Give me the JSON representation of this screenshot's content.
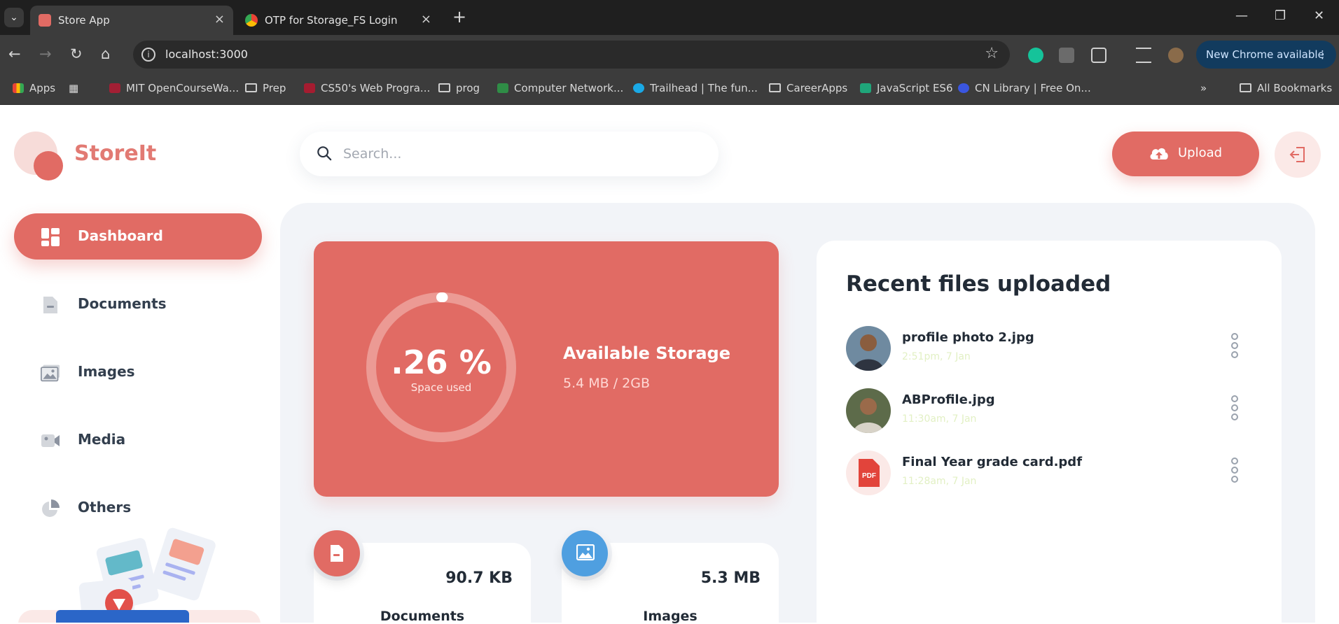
{
  "browser": {
    "tabs": [
      {
        "title": "Store App"
      },
      {
        "title": "OTP for Storage_FS Login - adit"
      }
    ],
    "url": "localhost:3000",
    "update_label": "New Chrome available",
    "bookmarks": [
      "Apps",
      "MIT OpenCourseWa...",
      "Prep",
      "CS50's Web Progra...",
      "prog",
      "Computer Network...",
      "Trailhead | The fun...",
      "CareerApps",
      "JavaScript ES6",
      "CN Library | Free On..."
    ],
    "all_bookmarks": "All Bookmarks"
  },
  "app": {
    "brand": "StoreIt",
    "search_placeholder": "Search...",
    "upload_label": "Upload",
    "accent": "#e16b64",
    "sidebar": [
      {
        "label": "Dashboard",
        "icon": "dashboard-icon",
        "active": true
      },
      {
        "label": "Documents",
        "icon": "document-icon",
        "active": false
      },
      {
        "label": "Images",
        "icon": "images-icon",
        "active": false
      },
      {
        "label": "Media",
        "icon": "video-icon",
        "active": false
      },
      {
        "label": "Others",
        "icon": "pie-chart-icon",
        "active": false
      }
    ],
    "storage": {
      "percent": ".26 %",
      "percent_label": "Space used",
      "used_fraction": 0.0026,
      "title": "Available Storage",
      "usage": "5.4 MB / 2GB"
    },
    "summary": [
      {
        "title": "Documents",
        "size": "90.7 KB",
        "color": "#e16b64",
        "icon": "document-icon"
      },
      {
        "title": "Images",
        "size": "5.3 MB",
        "color": "#4f9fe0",
        "icon": "images-icon"
      }
    ],
    "recent": {
      "title": "Recent files uploaded",
      "files": [
        {
          "name": "profile photo 2.jpg",
          "date": "2:51pm, 7 Jan",
          "kind": "photo"
        },
        {
          "name": "ABProfile.jpg",
          "date": "11:30am, 7 Jan",
          "kind": "photo"
        },
        {
          "name": "Final Year grade card.pdf",
          "date": "11:28am, 7 Jan",
          "kind": "pdf",
          "badge": "PDF"
        }
      ]
    }
  }
}
